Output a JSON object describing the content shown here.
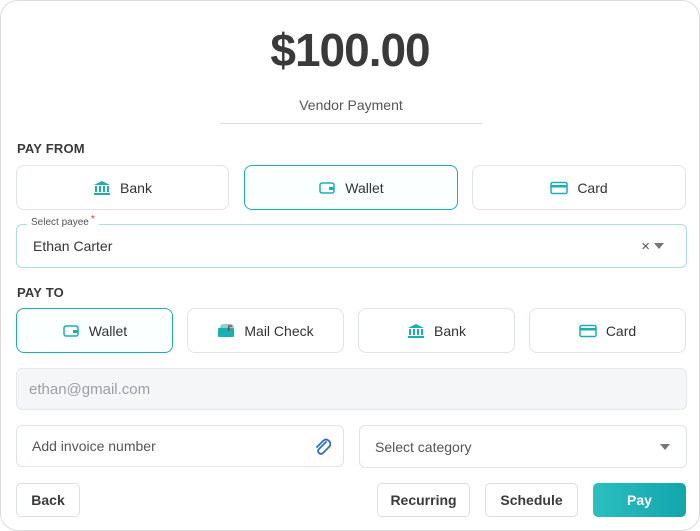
{
  "amount": "$100.00",
  "description": "Vendor Payment",
  "pay_from": {
    "label": "PAY FROM",
    "selected": "Wallet",
    "options": [
      {
        "label": "Bank",
        "icon": "bank-icon"
      },
      {
        "label": "Wallet",
        "icon": "wallet-icon"
      },
      {
        "label": "Card",
        "icon": "card-icon"
      }
    ]
  },
  "payee": {
    "label": "Select payee",
    "required_mark": "*",
    "value": "Ethan Carter",
    "clear": "×"
  },
  "pay_to": {
    "label": "PAY TO",
    "selected": "Wallet",
    "options": [
      {
        "label": "Wallet",
        "icon": "wallet-icon"
      },
      {
        "label": "Mail Check",
        "icon": "mailbox-icon"
      },
      {
        "label": "Bank",
        "icon": "bank-icon"
      },
      {
        "label": "Card",
        "icon": "card-icon"
      }
    ]
  },
  "email": "ethan@gmail.com",
  "invoice": {
    "placeholder": "Add invoice number"
  },
  "category": {
    "placeholder": "Select category"
  },
  "buttons": {
    "back": "Back",
    "recurring": "Recurring",
    "schedule": "Schedule",
    "pay": "Pay"
  },
  "colors": {
    "accent": "#1ab0b3",
    "icon": "#1ab0b3",
    "paperclip": "#2a6fd6"
  }
}
